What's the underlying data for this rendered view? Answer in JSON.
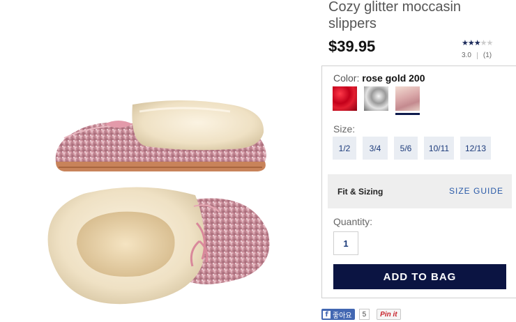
{
  "product": {
    "title": "Cozy glitter moccasin slippers",
    "price": "$39.95",
    "rating": {
      "stars_filled": 3,
      "stars_total": 5,
      "score": "3.0",
      "count": "(1)"
    }
  },
  "color": {
    "label": "Color:",
    "selected": "rose gold 200",
    "swatches": [
      {
        "name": "red glitter",
        "icon": "red-glitter-swatch",
        "selected": false
      },
      {
        "name": "silver glitter",
        "icon": "silver-glitter-swatch",
        "selected": false
      },
      {
        "name": "rose gold 200",
        "icon": "rose-gold-swatch",
        "selected": true
      }
    ]
  },
  "size": {
    "label": "Size:",
    "options": [
      "1/2",
      "3/4",
      "5/6",
      "10/11",
      "12/13"
    ]
  },
  "fit": {
    "label": "Fit & Sizing",
    "guide_link": "SIZE GUIDE"
  },
  "quantity": {
    "label": "Quantity:",
    "value": "1"
  },
  "actions": {
    "add_to_bag": "ADD TO BAG"
  },
  "social": {
    "fb_label": "좋아요",
    "fb_count": "5",
    "pinit_label": "Pin it"
  },
  "colors": {
    "brand_navy": "#0b1442",
    "link_blue": "#2a5aa8",
    "size_bg": "#e9edf3",
    "fit_bg": "#eeeeee"
  }
}
